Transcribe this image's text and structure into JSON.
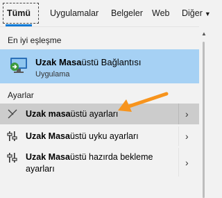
{
  "tabs": [
    {
      "label": "Tümü",
      "active": true
    },
    {
      "label": "Uygulamalar",
      "active": false
    },
    {
      "label": "Belgeler",
      "active": false
    },
    {
      "label": "Web",
      "active": false
    },
    {
      "label": "Diğer",
      "active": false,
      "dropdown_icon": "chevron-down-icon"
    }
  ],
  "best_match": {
    "section_label": "En iyi eşleşme",
    "title_bold": "Uzak Masa",
    "title_rest": "üstü Bağlantısı",
    "subtitle": "Uygulama",
    "icon": "remote-desktop-icon"
  },
  "settings": {
    "section_label": "Ayarlar",
    "items": [
      {
        "bold": "Uzak masa",
        "rest": "üstü ayarları",
        "icon": "remote-tools-icon",
        "highlighted": true
      },
      {
        "bold": "Uzak Masa",
        "rest": "üstü uyku ayarları",
        "icon": "settings-sliders-icon"
      },
      {
        "bold": "Uzak Masa",
        "rest": "üstü hazırda bekleme",
        "line2": "ayarları",
        "icon": "settings-sliders-icon"
      }
    ]
  },
  "expand_icon": "chevron-right-icon",
  "annotation_color": "#f7941d",
  "accent_color": "#0078d7",
  "selection_color": "#a6d1f4"
}
